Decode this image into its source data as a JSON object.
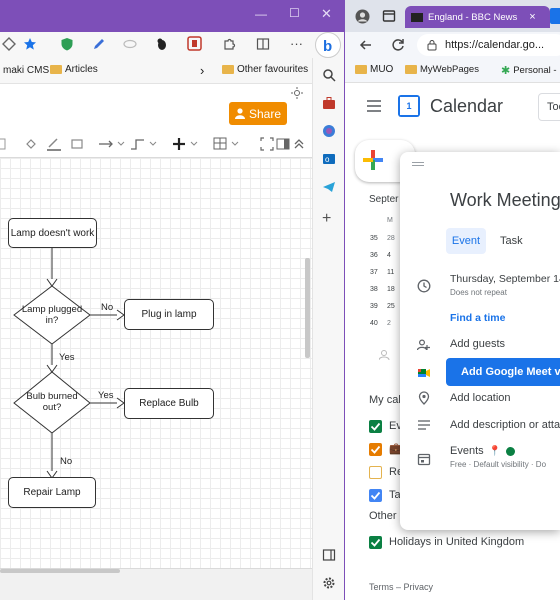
{
  "left_window": {
    "title_controls": {
      "minimize": "—",
      "maximize": "☐",
      "close": "✕"
    },
    "favorites": {
      "item1": "maki CMS",
      "item2": "Articles",
      "overflow": "›",
      "other": "Other favourites"
    },
    "drawio": {
      "share_label": "Share"
    },
    "flowchart": {
      "n1": "Lamp doesn't work",
      "n2": "Lamp plugged in?",
      "n3": "Plug in lamp",
      "n4": "Bulb burned out?",
      "n5": "Replace Bulb",
      "n6": "Repair Lamp",
      "e_no1": "No",
      "e_yes1": "Yes",
      "e_yes2": "Yes",
      "e_no2": "No"
    }
  },
  "right_window": {
    "tab": {
      "label": "England - BBC News",
      "close": "×"
    },
    "address": {
      "url": "https://calendar.go..."
    },
    "favorites": [
      "MUO",
      "MyWebPages",
      "Personal -"
    ],
    "calendar": {
      "app_name": "Calendar",
      "today_label": "Too",
      "month_label": "Septer",
      "weekday_letter": "M",
      "weeks": [
        {
          "wk": "35",
          "day": "28"
        },
        {
          "wk": "36",
          "day": "4"
        },
        {
          "wk": "37",
          "day": "11"
        },
        {
          "wk": "38",
          "day": "18"
        },
        {
          "wk": "39",
          "day": "25"
        },
        {
          "wk": "40",
          "day": "2"
        }
      ],
      "my_calendars": "My cal",
      "calendars": [
        {
          "label": "Ev",
          "color": "#0b8043",
          "checked": true
        },
        {
          "label": "💼",
          "color": "#e67c00",
          "checked": true
        },
        {
          "label": "Re",
          "color": "#e4b34f",
          "checked": false
        },
        {
          "label": "Ta",
          "color": "#4285f4",
          "checked": true
        }
      ],
      "other_label": "Other",
      "holidays": "Holidays in United Kingdom",
      "footer": "Terms – Privacy"
    },
    "event": {
      "title": "Work Meeting",
      "tab_event": "Event",
      "tab_task": "Task",
      "date": "Thursday, September 14",
      "repeat": "Does not repeat",
      "find_time": "Find a time",
      "add_guests": "Add guests",
      "meet_button": "Add Google Meet vi",
      "add_location": "Add location",
      "add_description": "Add description or attac",
      "calendar_name": "Events",
      "visibility": "Free · Default visibility · Do"
    }
  }
}
